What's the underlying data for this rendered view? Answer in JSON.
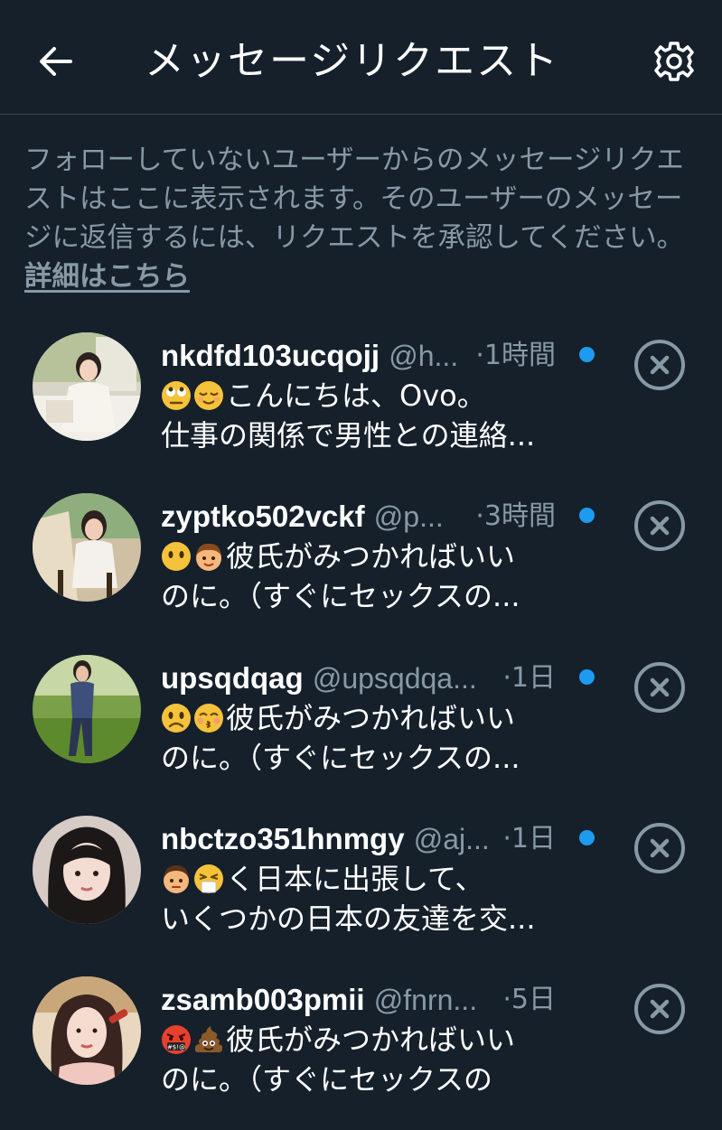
{
  "header": {
    "title": "メッセージリクエスト"
  },
  "description": {
    "text": "フォローしていないユーザーからのメッセージリクエストはここに表示されます。そのユーザーのメッセージに返信するには、リクエストを承認してください。",
    "link": "詳細はこちら"
  },
  "requests": [
    {
      "name": "nkdfd103ucqojj",
      "handle": "@h...",
      "time": "·1時間",
      "emojis": [
        "face-with-rolling-eyes",
        "relieved-face"
      ],
      "line1": "こんにちは、Ovo。",
      "line2": "仕事の関係で男性との連絡...",
      "unread": true
    },
    {
      "name": "zyptko502vckf",
      "handle": "@p...",
      "time": "·3時間",
      "emojis": [
        "face-without-mouth",
        "boy"
      ],
      "line1": "彼氏がみつかればいい",
      "line2": "のに。（すぐにセックスの...",
      "unread": true
    },
    {
      "name": "upsqdqag",
      "handle": "@upsqdqa...",
      "time": "·1日",
      "emojis": [
        "slightly-frowning-face",
        "kissing-face-closed-eyes"
      ],
      "line1": "彼氏がみつかればいい",
      "line2": "のに。（すぐにセックスの...",
      "unread": true
    },
    {
      "name": "nbctzo351hnmgy",
      "handle": "@aj...",
      "time": "·1日",
      "emojis": [
        "man",
        "sneezing-face"
      ],
      "line1": "く日本に出張して、",
      "line2": "いくつかの日本の友達を交...",
      "unread": true
    },
    {
      "name": "zsamb003pmii",
      "handle": "@fnrn...",
      "time": "·5日",
      "emojis": [
        "face-with-symbols-on-mouth",
        "pile-of-poo"
      ],
      "line1": "彼氏がみつかればいい",
      "line2": "のに。（すぐにセックスの",
      "unread": false
    }
  ],
  "colors": {
    "background": "#15202b",
    "secondary_text": "#8899a6",
    "unread_dot": "#1d9bf0",
    "divider": "#38444d"
  }
}
